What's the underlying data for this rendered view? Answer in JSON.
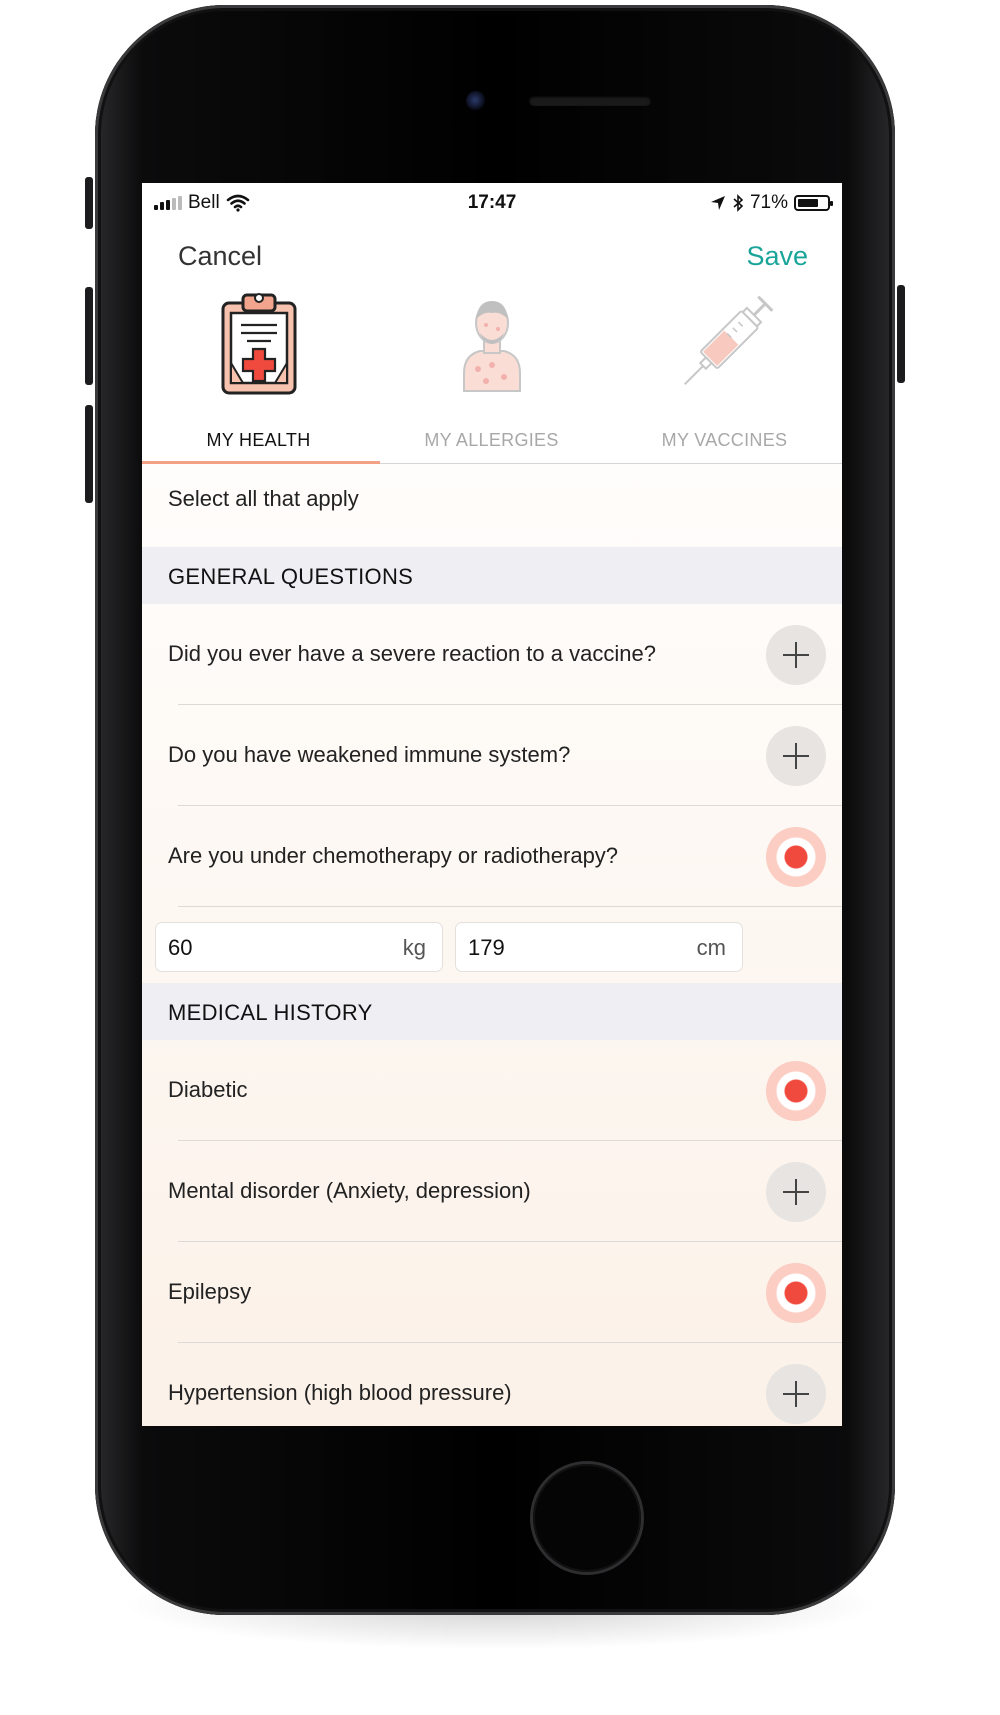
{
  "status_bar": {
    "carrier": "Bell",
    "time": "17:47",
    "battery_percent": "71%",
    "battery_level": 0.71
  },
  "nav": {
    "cancel_label": "Cancel",
    "save_label": "Save",
    "save_color": "#1aa59a"
  },
  "tabs": [
    {
      "label": "MY HEALTH",
      "icon": "clipboard-medical-icon",
      "active": true
    },
    {
      "label": "MY ALLERGIES",
      "icon": "allergy-person-icon",
      "active": false
    },
    {
      "label": "MY VACCINES",
      "icon": "syringe-icon",
      "active": false
    }
  ],
  "hint": "Select all that apply",
  "sections": {
    "general": {
      "title": "GENERAL QUESTIONS",
      "items": [
        {
          "label": "Did you ever have a severe reaction to a vaccine?",
          "selected": false
        },
        {
          "label": "Do you have weakened immune system?",
          "selected": false
        },
        {
          "label": "Are you under chemotherapy or radiotherapy?",
          "selected": true
        }
      ]
    },
    "measurements": {
      "weight": {
        "value": "60",
        "unit": "kg"
      },
      "height": {
        "value": "179",
        "unit": "cm"
      }
    },
    "history": {
      "title": "MEDICAL HISTORY",
      "items": [
        {
          "label": "Diabetic",
          "selected": true
        },
        {
          "label": "Mental disorder (Anxiety, depression)",
          "selected": false
        },
        {
          "label": "Epilepsy",
          "selected": true
        },
        {
          "label": "Hypertension (high blood pressure)",
          "selected": false
        }
      ]
    }
  },
  "colors": {
    "accent_selected": "#f04a3e",
    "tab_underline": "#f2a185"
  }
}
